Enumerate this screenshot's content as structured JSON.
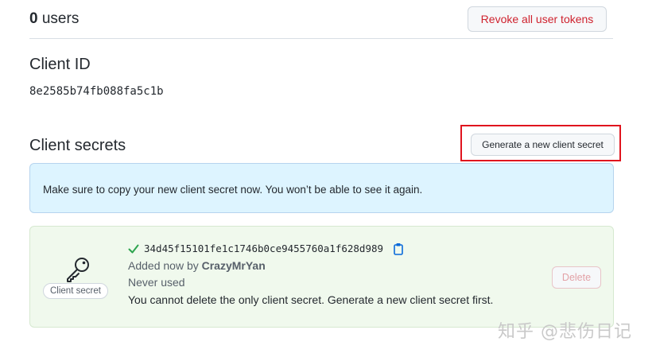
{
  "users": {
    "count": "0",
    "label": "users",
    "revoke_label": "Revoke all user tokens"
  },
  "client_id": {
    "title": "Client ID",
    "value": "8e2585b74fb088fa5c1b"
  },
  "client_secrets": {
    "title": "Client secrets",
    "generate_label": "Generate a new client secret",
    "flash_message": "Make sure to copy your new client secret now. You won’t be able to see it again.",
    "secret": {
      "badge_label": "Client secret",
      "value": "34d45f15101fe1c1746b0ce9455760a1f628d989",
      "added_prefix": "Added now by",
      "added_by": "CrazyMrYan",
      "usage": "Never used",
      "delete_note": "You cannot delete the only client secret. Generate a new client secret first.",
      "delete_label": "Delete"
    }
  },
  "watermark": "知乎 @悲伤日记",
  "colors": {
    "danger": "#cf222e",
    "highlight": "#e0141e",
    "info_bg": "#ddf4ff",
    "success_bg": "#f0f9ed",
    "check": "#2da44e",
    "copy_icon": "#0969da"
  },
  "icons": {
    "key": "key-icon",
    "check": "check-icon",
    "copy": "copy-icon"
  }
}
